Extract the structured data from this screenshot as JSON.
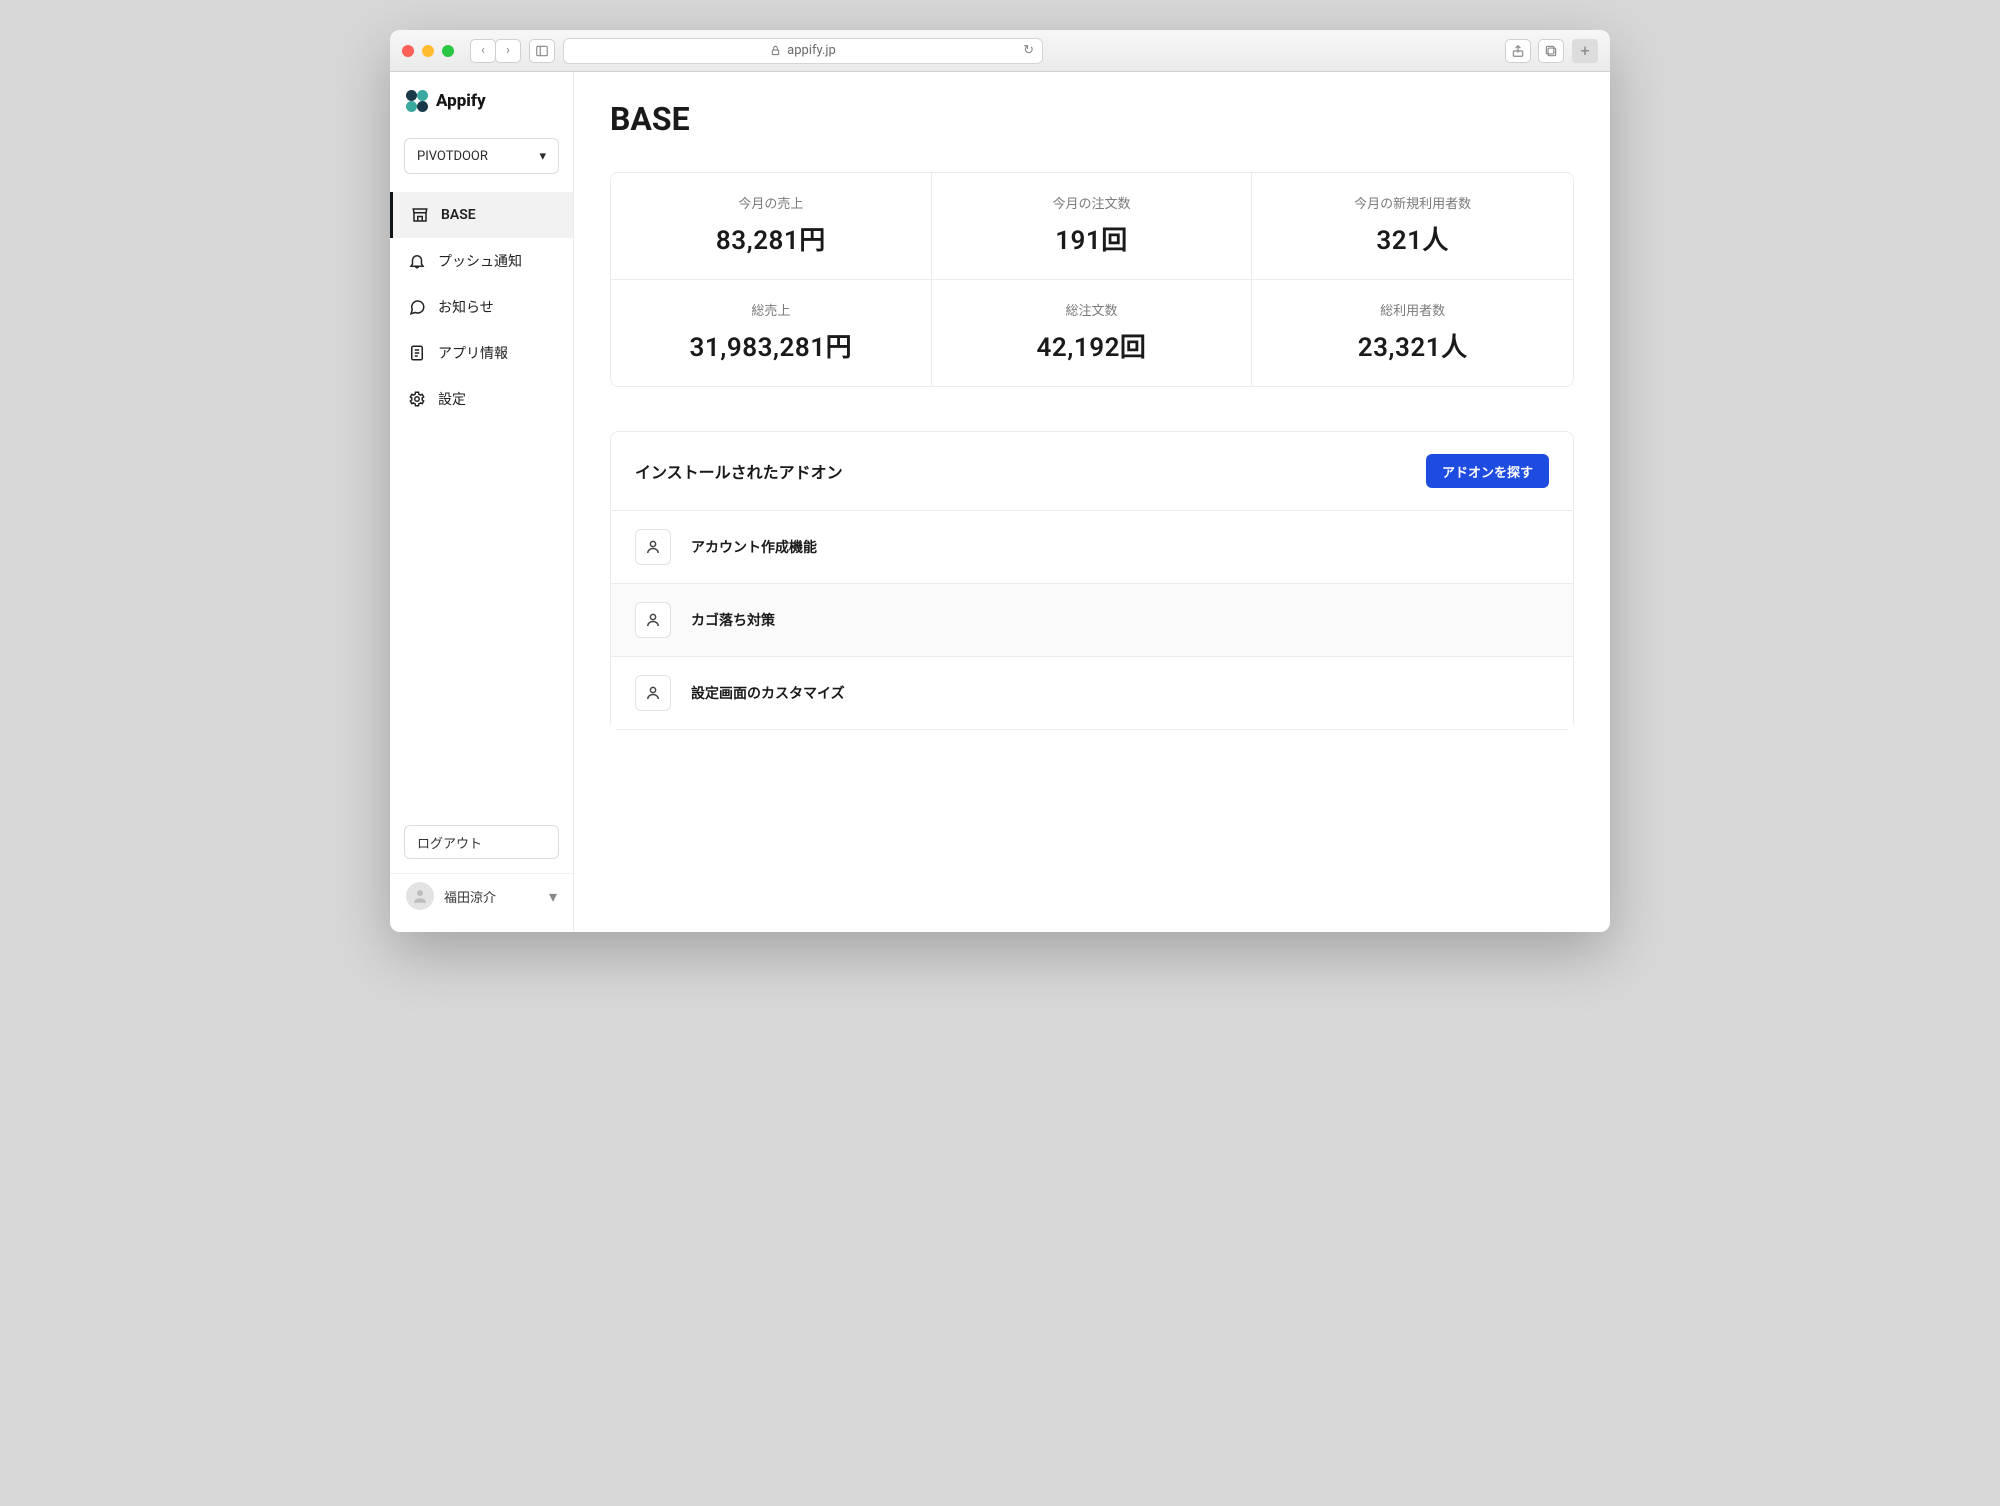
{
  "browser": {
    "url": "appify.jp"
  },
  "brand": {
    "name": "Appify"
  },
  "project_selector": {
    "value": "PIVOTDOOR"
  },
  "nav": {
    "items": [
      {
        "label": "BASE"
      },
      {
        "label": "プッシュ通知"
      },
      {
        "label": "お知らせ"
      },
      {
        "label": "アプリ情報"
      },
      {
        "label": "設定"
      }
    ]
  },
  "footer": {
    "logout_label": "ログアウト",
    "user_name": "福田涼介"
  },
  "page": {
    "title": "BASE",
    "stats": [
      {
        "label": "今月の売上",
        "value": "83,281円"
      },
      {
        "label": "今月の注文数",
        "value": "191回"
      },
      {
        "label": "今月の新規利用者数",
        "value": "321人"
      },
      {
        "label": "総売上",
        "value": "31,983,281円"
      },
      {
        "label": "総注文数",
        "value": "42,192回"
      },
      {
        "label": "総利用者数",
        "value": "23,321人"
      }
    ],
    "addons": {
      "title": "インストールされたアドオン",
      "button_label": "アドオンを探す",
      "items": [
        {
          "name": "アカウント作成機能"
        },
        {
          "name": "カゴ落ち対策"
        },
        {
          "name": "設定画面のカスタマイズ"
        }
      ]
    }
  }
}
